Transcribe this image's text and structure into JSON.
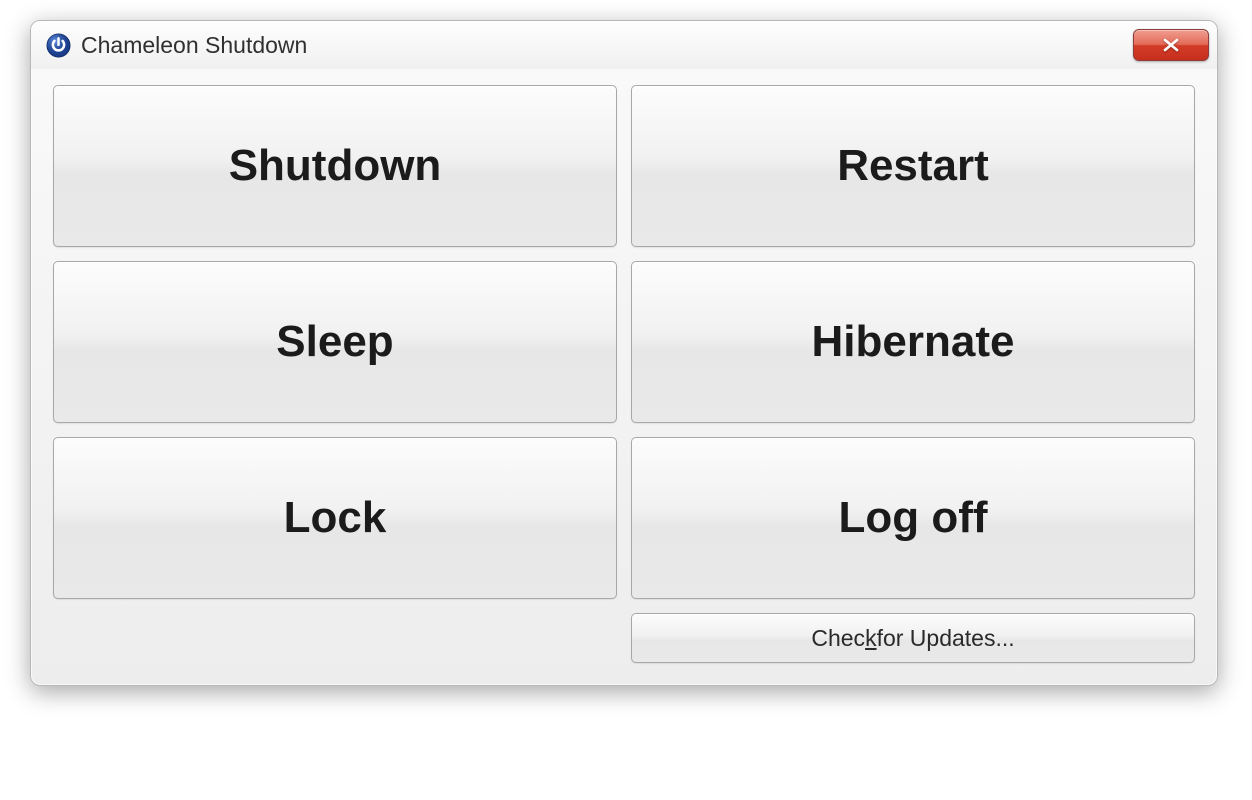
{
  "window": {
    "title": "Chameleon Shutdown",
    "app_icon": "power-icon"
  },
  "titlebar": {
    "close_tooltip": "Close"
  },
  "actions": {
    "shutdown": {
      "label": "Shutdown"
    },
    "restart": {
      "label": "Restart"
    },
    "sleep": {
      "label": "Sleep"
    },
    "hibernate": {
      "label": "Hibernate"
    },
    "lock": {
      "label": "Lock"
    },
    "logoff": {
      "label": "Log off"
    }
  },
  "footer": {
    "update_prefix": "Chec",
    "update_mnemonic": "k",
    "update_suffix": " for Updates..."
  }
}
